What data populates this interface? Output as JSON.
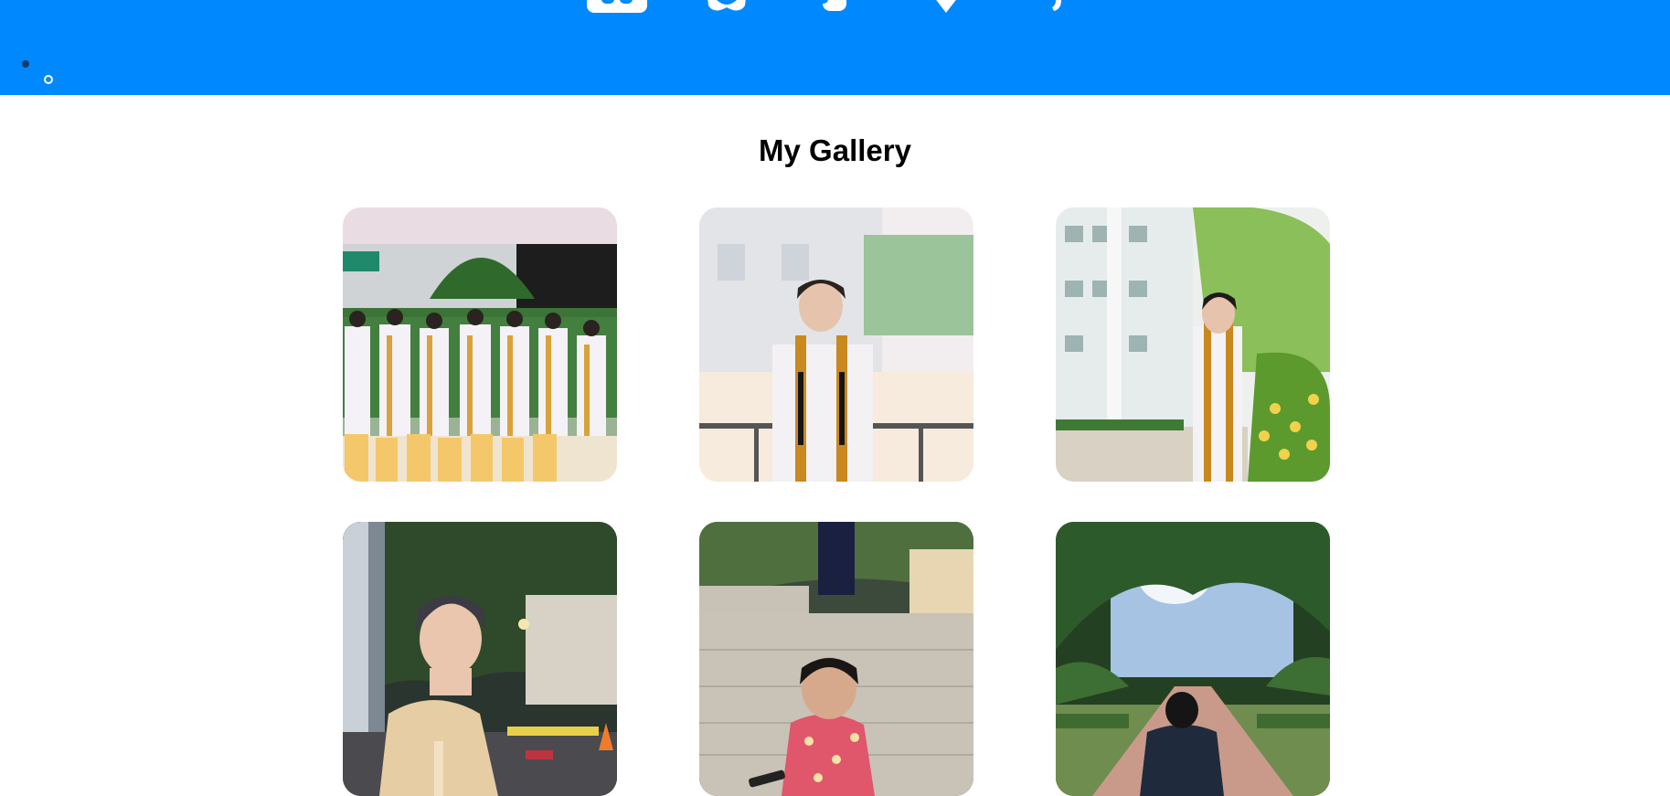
{
  "nav": {
    "icons": [
      {
        "name": "home-icon"
      },
      {
        "name": "gamepad-icon"
      },
      {
        "name": "coffee-icon"
      },
      {
        "name": "heart-icon"
      },
      {
        "name": "music-icon"
      }
    ],
    "bar_color": "#0088ff"
  },
  "gallery": {
    "title": "My Gallery",
    "photos": [
      {
        "subject": "graduation-group-photo",
        "colors": [
          "#e9dce2",
          "#3d7a3a",
          "#f4c86a"
        ]
      },
      {
        "subject": "graduate-leaning-on-railing",
        "colors": [
          "#f2eef0",
          "#9cc49a",
          "#f3e4c8"
        ]
      },
      {
        "subject": "graduate-by-building",
        "colors": [
          "#e6ecec",
          "#8bbf5a",
          "#f2d24a"
        ]
      },
      {
        "subject": "man-at-night-street",
        "colors": [
          "#2a3530",
          "#e6cda3",
          "#7d8892"
        ]
      },
      {
        "subject": "man-on-steps-at-night",
        "colors": [
          "#3b4a3a",
          "#c9c2b6",
          "#e0566a"
        ]
      },
      {
        "subject": "man-walking-on-path",
        "colors": [
          "#244022",
          "#a7c3e3",
          "#c99a8a"
        ]
      }
    ]
  }
}
